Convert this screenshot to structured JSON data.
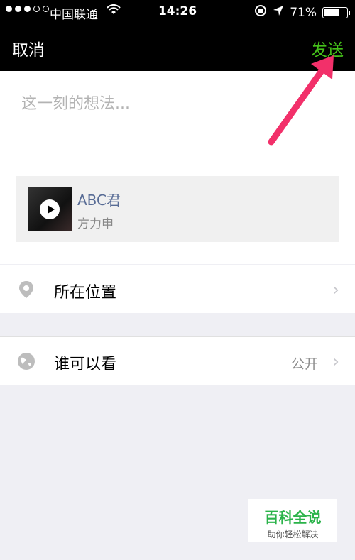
{
  "status_bar": {
    "carrier": "中国联通",
    "time": "14:26",
    "battery_percent": "71%"
  },
  "nav": {
    "cancel_label": "取消",
    "send_label": "发送"
  },
  "compose": {
    "placeholder": "这一刻的想法..."
  },
  "music": {
    "title": "ABC君",
    "artist": "方力申"
  },
  "location": {
    "label": "所在位置"
  },
  "visibility": {
    "label": "谁可以看",
    "value": "公开"
  },
  "watermark": {
    "name": "百科全说",
    "tagline": "助你轻松解决"
  },
  "colors": {
    "send": "#45c01a",
    "link": "#576b95",
    "arrow": "#f2306a"
  }
}
